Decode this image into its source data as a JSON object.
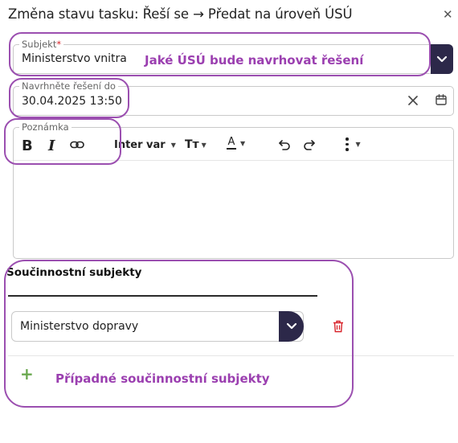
{
  "dialog": {
    "title": "Změna stavu tasku: Řeší se → Předat na úroveň ÚSÚ",
    "close_icon": "close-icon"
  },
  "subject_field": {
    "label": "Subjekt",
    "required_mark": "*",
    "value": "Ministerstvo vnitra",
    "annotation": "Jaké ÚSÚ bude navrhovat řešení"
  },
  "deadline_field": {
    "label": "Navrhněte řešení do",
    "value": "30.04.2025 13:50"
  },
  "note_field": {
    "label": "Poznámka",
    "toolbar": {
      "bold": "B",
      "italic": "I",
      "font": "Inter var",
      "size": "Tт",
      "color": "A"
    }
  },
  "cooperating": {
    "title": "Součinnostní subjekty",
    "items": [
      {
        "value": "Ministerstvo dopravy"
      }
    ],
    "add_annotation": "Případné součinnostní subjekty",
    "add_symbol": "+"
  },
  "colors": {
    "accent_dark": "#2c2849",
    "annotation": "#9b3fb0",
    "delete": "#d8232a",
    "add": "#6aa84f"
  }
}
